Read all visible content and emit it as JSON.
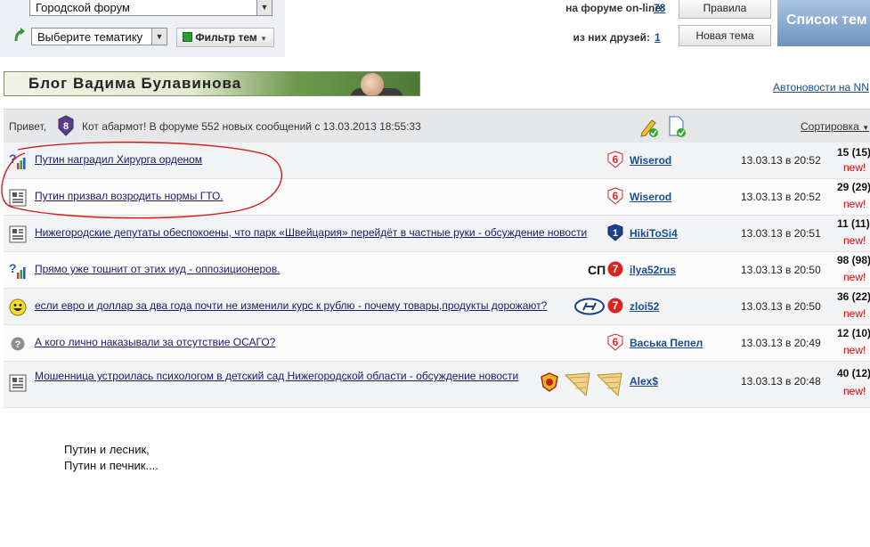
{
  "top": {
    "forum_select": "Городской форум",
    "topic_select": "Выберите тематику",
    "filter_label": "Фильтр тем",
    "online_label": "на форуме on-line:",
    "online_count": "78",
    "friends_label": "из них друзей:",
    "friends_count": "1",
    "rules_button": "Правила",
    "new_topic_button": "Новая тема",
    "forum_list_button": "Список тем"
  },
  "banner": {
    "title": "Блог Вадима Булавинова"
  },
  "autonews_link": "Автоновости на NN",
  "header": {
    "greeting": "Привет,",
    "user_rank": "8",
    "message": "Кот абармот! В форуме 552 новых сообщений с 13.03.2013 18:55:33",
    "sort_label": "Сортировка"
  },
  "topics": [
    {
      "title": "Путин наградил Хирурга орденом",
      "rank": "6",
      "author": "Wiserod",
      "date": "13.03.13 в 20:52",
      "count": "15 (15)",
      "new": "new!"
    },
    {
      "title": "Путин призвал возродить нормы ГТО.",
      "rank": "6",
      "author": "Wiserod",
      "date": "13.03.13 в 20:52",
      "count": "29 (29)",
      "new": "new!"
    },
    {
      "title": "Нижегородские депутаты обеспокоены, что парк «Швейцария» перейдёт в частные руки - обсуждение новости",
      "rank": "1",
      "author": "HikiToSi4",
      "date": "13.03.13 в 20:51",
      "count": "11 (11)",
      "new": "new!"
    },
    {
      "title": "Прямо уже тошнит от этих иуд - оппозиционеров.",
      "prefix": "СП",
      "rank": "7",
      "author": "ilya52rus",
      "date": "13.03.13 в 20:50",
      "count": "98 (98)",
      "new": "new!"
    },
    {
      "title": "если евро и доллар за два года почти не изменили курс к рублю - почему товары,продукты дорожают?",
      "rank": "7",
      "author": "zloi52",
      "date": "13.03.13 в 20:50",
      "count": "36 (22)",
      "new": "new!"
    },
    {
      "title": "А кого лично наказывали за отсутствие ОСАГО?",
      "rank": "6",
      "author": "Васька Пепел",
      "date": "13.03.13 в 20:49",
      "count": "12 (10)",
      "new": "new!"
    },
    {
      "title": "Мошенница устроилась психологом в детский сад Нижегородской области - обсуждение новости",
      "author": "Alex$",
      "date": "13.03.13 в 20:48",
      "count": "40 (12)",
      "new": "new!"
    }
  ],
  "caption": "Путин и лесник,\nПутин и печник...."
}
